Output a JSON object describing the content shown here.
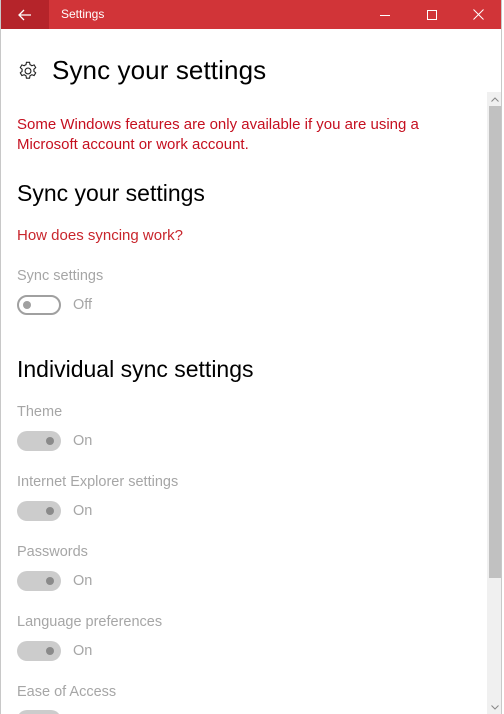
{
  "window": {
    "title": "Settings",
    "accent_color": "#d13438"
  },
  "page": {
    "title": "Sync your settings",
    "warning": "Some Windows features are only available if you are using a Microsoft account or work account."
  },
  "sync_section": {
    "title": "Sync your settings",
    "link": "How does syncing work?",
    "sync_setting": {
      "label": "Sync settings",
      "state": "Off",
      "on": false
    }
  },
  "individual_section": {
    "title": "Individual sync settings",
    "items": [
      {
        "label": "Theme",
        "state": "On",
        "on": true
      },
      {
        "label": "Internet Explorer settings",
        "state": "On",
        "on": true
      },
      {
        "label": "Passwords",
        "state": "On",
        "on": true
      },
      {
        "label": "Language preferences",
        "state": "On",
        "on": true
      },
      {
        "label": "Ease of Access"
      }
    ]
  },
  "icons": {
    "back": "back-arrow-icon",
    "settings": "gear-icon",
    "minimize": "minimize-icon",
    "maximize": "maximize-icon",
    "close": "close-icon"
  }
}
